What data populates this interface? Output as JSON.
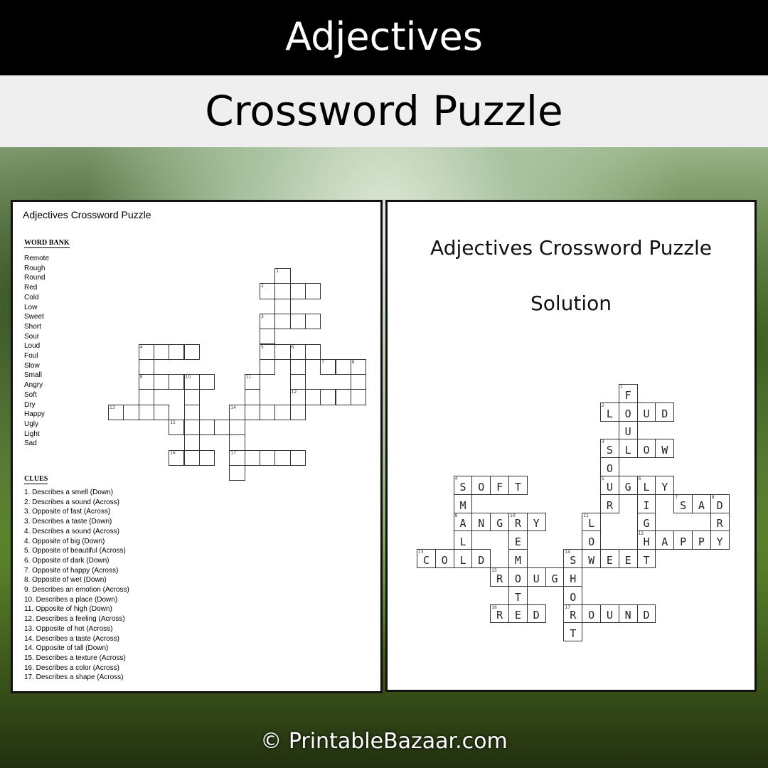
{
  "banner": {
    "title": "Adjectives",
    "subtitle": "Crossword Puzzle"
  },
  "worksheet": {
    "title": "Adjectives Crossword Puzzle",
    "word_bank_heading": "WORD BANK",
    "word_bank": [
      "Remote",
      "Rough",
      "Round",
      "Red",
      "Cold",
      "Low",
      "Sweet",
      "Short",
      "Sour",
      "Loud",
      "Foul",
      "Slow",
      "Small",
      "Angry",
      "Soft",
      "Dry",
      "Happy",
      "Ugly",
      "Light",
      "Sad"
    ],
    "clues_heading": "CLUES",
    "clues": [
      "1. Describes a smell (Down)",
      "2. Describes a sound (Across)",
      "3. Opposite of fast (Across)",
      "3. Describes a taste (Down)",
      "4. Describes a sound (Across)",
      "4. Opposite of big (Down)",
      "5. Opposite of beautiful (Across)",
      "6. Opposite of dark (Down)",
      "7. Opposite of happy (Across)",
      "8. Opposite of wet (Down)",
      "9. Describes an emotion  (Across)",
      "10. Describes a place (Down)",
      "11. Opposite of high (Down)",
      "12. Describes a feeling (Across)",
      "13. Opposite of hot (Across)",
      "14. Describes a taste (Across)",
      "14. Opposite of tall (Down)",
      "15. Describes a texture (Across)",
      "16. Describes a color (Across)",
      "17. Describes a shape (Across)"
    ]
  },
  "solution": {
    "title": "Adjectives Crossword Puzzle",
    "subtitle": "Solution"
  },
  "answers": [
    {
      "num": 1,
      "dir": "down",
      "word": "FOUL"
    },
    {
      "num": 2,
      "dir": "across",
      "word": "LOUD"
    },
    {
      "num": 3,
      "dir": "across",
      "word": "SLOW"
    },
    {
      "num": 3,
      "dir": "down",
      "word": "SOUR"
    },
    {
      "num": 4,
      "dir": "across",
      "word": "SOFT"
    },
    {
      "num": 4,
      "dir": "down",
      "word": "SMALL"
    },
    {
      "num": 5,
      "dir": "across",
      "word": "UGLY"
    },
    {
      "num": 6,
      "dir": "down",
      "word": "LIGHT"
    },
    {
      "num": 7,
      "dir": "across",
      "word": "SAD"
    },
    {
      "num": 8,
      "dir": "down",
      "word": "DRY"
    },
    {
      "num": 9,
      "dir": "across",
      "word": "ANGRY"
    },
    {
      "num": 10,
      "dir": "down",
      "word": "REMOTE"
    },
    {
      "num": 11,
      "dir": "down",
      "word": "LOW"
    },
    {
      "num": 12,
      "dir": "across",
      "word": "HAPPY"
    },
    {
      "num": 13,
      "dir": "across",
      "word": "COLD"
    },
    {
      "num": 14,
      "dir": "across",
      "word": "SWEET"
    },
    {
      "num": 14,
      "dir": "down",
      "word": "SHORT"
    },
    {
      "num": 15,
      "dir": "across",
      "word": "ROUGH"
    },
    {
      "num": 16,
      "dir": "across",
      "word": "RED"
    },
    {
      "num": 17,
      "dir": "across",
      "word": "ROUND"
    }
  ],
  "footer": "© PrintableBazaar.com"
}
